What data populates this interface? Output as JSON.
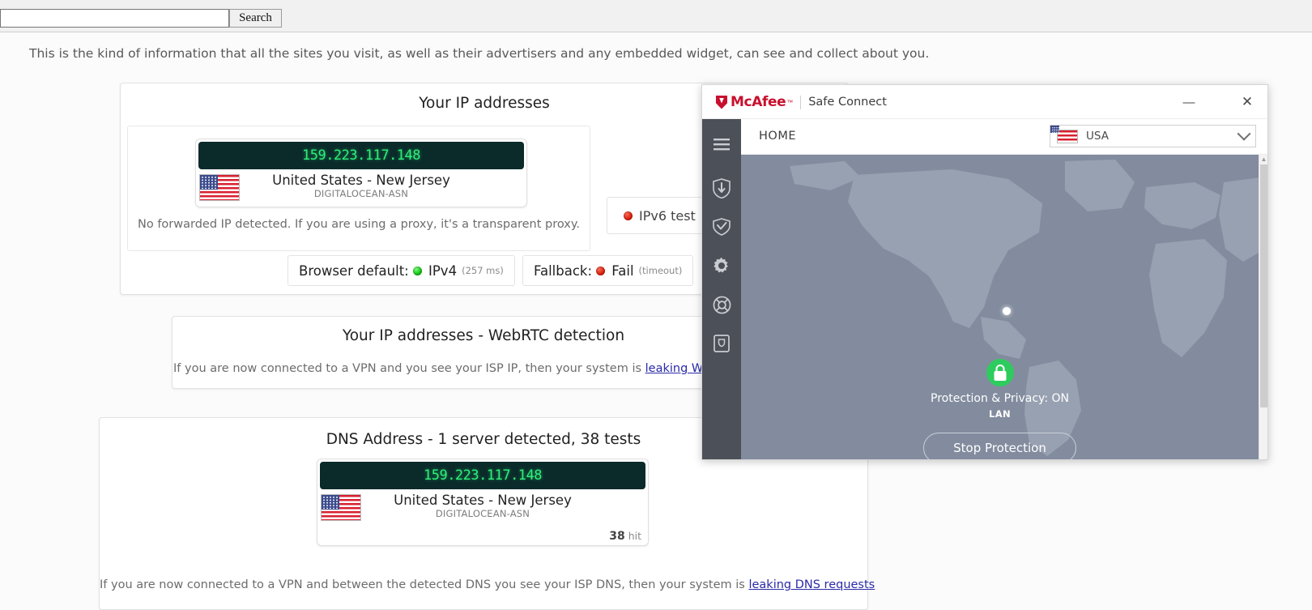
{
  "search": {
    "value": "",
    "placeholder": "",
    "button_label": "Search"
  },
  "page": {
    "intro": "This is the kind of information that all the sites you visit, as well as their advertisers and any embedded widget, can see and collect about you."
  },
  "ip_card": {
    "title": "Your IP addresses",
    "ip": "159.223.117.148",
    "country": "United States - New Jersey",
    "asn": "DIGITALOCEAN-ASN",
    "note": "No forwarded IP detected. If you are using a proxy, it's a transparent proxy.",
    "ipv6_test_label": "IPv6 test",
    "browser_default_prefix": "Browser default:",
    "browser_default_value": "IPv4",
    "browser_default_detail": "(257 ms)",
    "fallback_prefix": "Fallback:",
    "fallback_value": "Fail",
    "fallback_detail": "(timeout)"
  },
  "webrtc_card": {
    "title": "Your IP addresses - WebRTC detection",
    "text_before": "If you are now connected to a VPN and you see your ISP IP, then your system is ",
    "link": "leaking WebRTC requests"
  },
  "dns_card": {
    "title": "DNS Address - 1 server detected, 38 tests",
    "ip": "159.223.117.148",
    "country": "United States - New Jersey",
    "asn": "DIGITALOCEAN-ASN",
    "hit_count": "38",
    "hit_label": "hit",
    "text_before": "If you are now connected to a VPN and between the detected DNS you see your ISP DNS, then your system is ",
    "link": "leaking DNS requests"
  },
  "mcafee": {
    "brand": "McAfee",
    "trademark": "™",
    "product": "Safe Connect",
    "minimize_glyph": "—",
    "close_glyph": "✕",
    "nav_label": "HOME",
    "country": "USA",
    "sidebar": [
      {
        "name": "menu-icon",
        "label": "Menu"
      },
      {
        "name": "vpn-shield-icon",
        "label": "VPN"
      },
      {
        "name": "shield-check-icon",
        "label": "Protection"
      },
      {
        "name": "gear-icon",
        "label": "Settings"
      },
      {
        "name": "lifebuoy-icon",
        "label": "Help"
      },
      {
        "name": "device-icon",
        "label": "Devices"
      }
    ],
    "status_main": "Protection & Privacy: ON",
    "status_sub": "LAN",
    "stop_button": "Stop Protection",
    "scroll_up_glyph": "▲"
  },
  "colors": {
    "brand_red": "#c8102e",
    "sidebar_dark": "#4c5058",
    "map_blue": "#828c9e",
    "status_green": "#2ecc5e",
    "ip_green": "#2ef07a",
    "ip_bg": "#0b2a2a",
    "link_blue": "#2a2aa8"
  }
}
